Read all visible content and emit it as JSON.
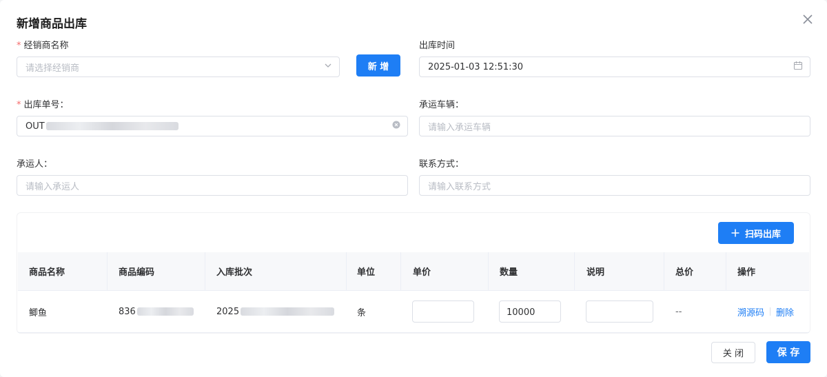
{
  "dialog": {
    "title": "新增商品出库"
  },
  "form": {
    "distributor": {
      "label": "经销商名称",
      "placeholder": "请选择经销商"
    },
    "add_button": "新 增",
    "out_time": {
      "label": "出库时间",
      "value": "2025-01-03 12:51:30"
    },
    "out_no": {
      "label": "出库单号：",
      "value_prefix": "OUT"
    },
    "vehicle": {
      "label": "承运车辆：",
      "placeholder": "请输入承运车辆"
    },
    "carrier": {
      "label": "承运人：",
      "placeholder": "请输入承运人"
    },
    "contact": {
      "label": "联系方式：",
      "placeholder": "请输入联系方式"
    }
  },
  "scan_button": "扫码出库",
  "table": {
    "columns": [
      "商品名称",
      "商品编码",
      "入库批次",
      "单位",
      "单价",
      "数量",
      "说明",
      "总价",
      "操作"
    ],
    "rows": [
      {
        "name": "鲫鱼",
        "code_prefix": "836",
        "batch_prefix": "2025",
        "unit": "条",
        "price": "",
        "qty": "10000",
        "note": "",
        "total": "--",
        "action_trace": "溯源码",
        "action_delete": "删除"
      }
    ]
  },
  "footer": {
    "close": "关 闭",
    "save": "保 存"
  },
  "colors": {
    "primary": "#1e7ef5",
    "required": "#f56c6c"
  }
}
